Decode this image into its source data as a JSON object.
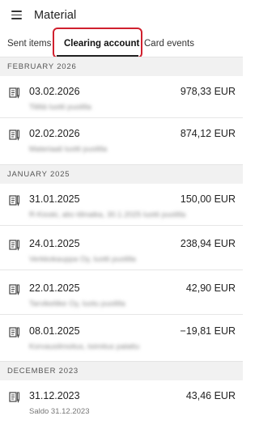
{
  "appbar": {
    "title": "Material",
    "menu_icon": "hamburger-menu-icon"
  },
  "tabs": [
    {
      "label": "Sent items",
      "active": false
    },
    {
      "label": "Clearing account",
      "active": true
    },
    {
      "label": "Card events",
      "active": false
    }
  ],
  "highlight_color": "#d0202e",
  "sections": [
    {
      "label": "FEBRUARY 2026"
    },
    {
      "label": "JANUARY 2025"
    },
    {
      "label": "DECEMBER 2023"
    }
  ],
  "rows": [
    {
      "date": "03.02.2026",
      "amount": "978,33 EUR",
      "subtitle": "Tililtä luotti puolilla"
    },
    {
      "date": "02.02.2026",
      "amount": "874,12 EUR",
      "subtitle": "Materiaali luotti puolilla"
    },
    {
      "date": "31.01.2025",
      "amount": "150,00 EUR",
      "subtitle": "R-Kioski, abc-tilinaika, 30.1.2025 luotti puolilla"
    },
    {
      "date": "24.01.2025",
      "amount": "238,94 EUR",
      "subtitle": "Verkkokauppa Oy, luotti puolilla"
    },
    {
      "date": "22.01.2025",
      "amount": "42,90 EUR",
      "subtitle": "Tarvikeliike Oy, luotu puolilla"
    },
    {
      "date": "08.01.2025",
      "amount": "−19,81 EUR",
      "subtitle": "Korvausilmoitus, toimitus palattu"
    },
    {
      "date": "31.12.2023",
      "amount": "43,46 EUR",
      "subtitle": "Saldo 31.12.2023"
    }
  ]
}
